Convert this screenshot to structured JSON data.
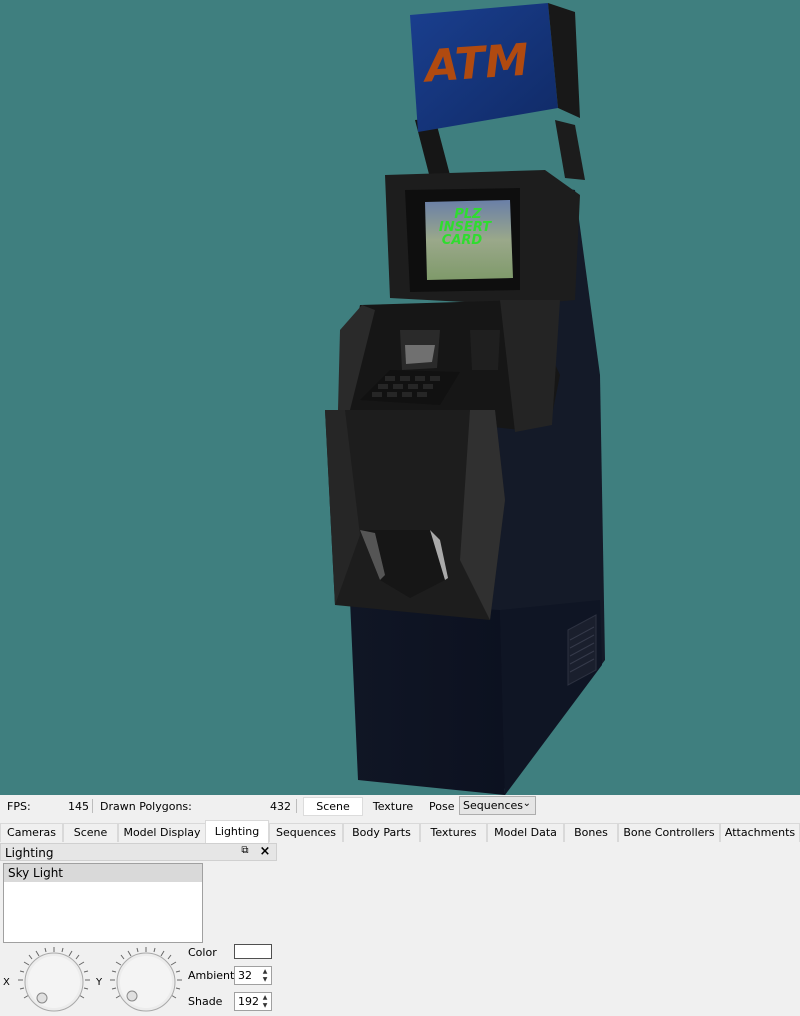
{
  "viewport": {
    "background_color": "#3f7f7f",
    "model_sign_text": "ATM",
    "screen_text_lines": [
      "PLZ",
      "INSERT",
      "CARD"
    ]
  },
  "status": {
    "fps_label": "FPS:",
    "fps_value": "145",
    "polygons_label": "Drawn Polygons:",
    "polygons_value": "432",
    "scene_button": "Scene",
    "texture_button": "Texture",
    "pose_label": "Pose",
    "pose_select": "Sequences"
  },
  "tabs": [
    "Cameras",
    "Scene",
    "Model Display",
    "Lighting",
    "Sequences",
    "Body Parts",
    "Textures",
    "Model Data",
    "Bones",
    "Bone Controllers",
    "Attachments"
  ],
  "active_tab": "Lighting",
  "panel": {
    "title": "Lighting",
    "float_icon": "float-icon",
    "close_icon": "close-icon",
    "lights": [
      "Sky Light"
    ],
    "x_label": "X",
    "y_label": "Y",
    "color_label": "Color",
    "color_value": "#ffffff",
    "ambient_label": "Ambient",
    "ambient_value": "32",
    "shade_label": "Shade",
    "shade_value": "192"
  }
}
